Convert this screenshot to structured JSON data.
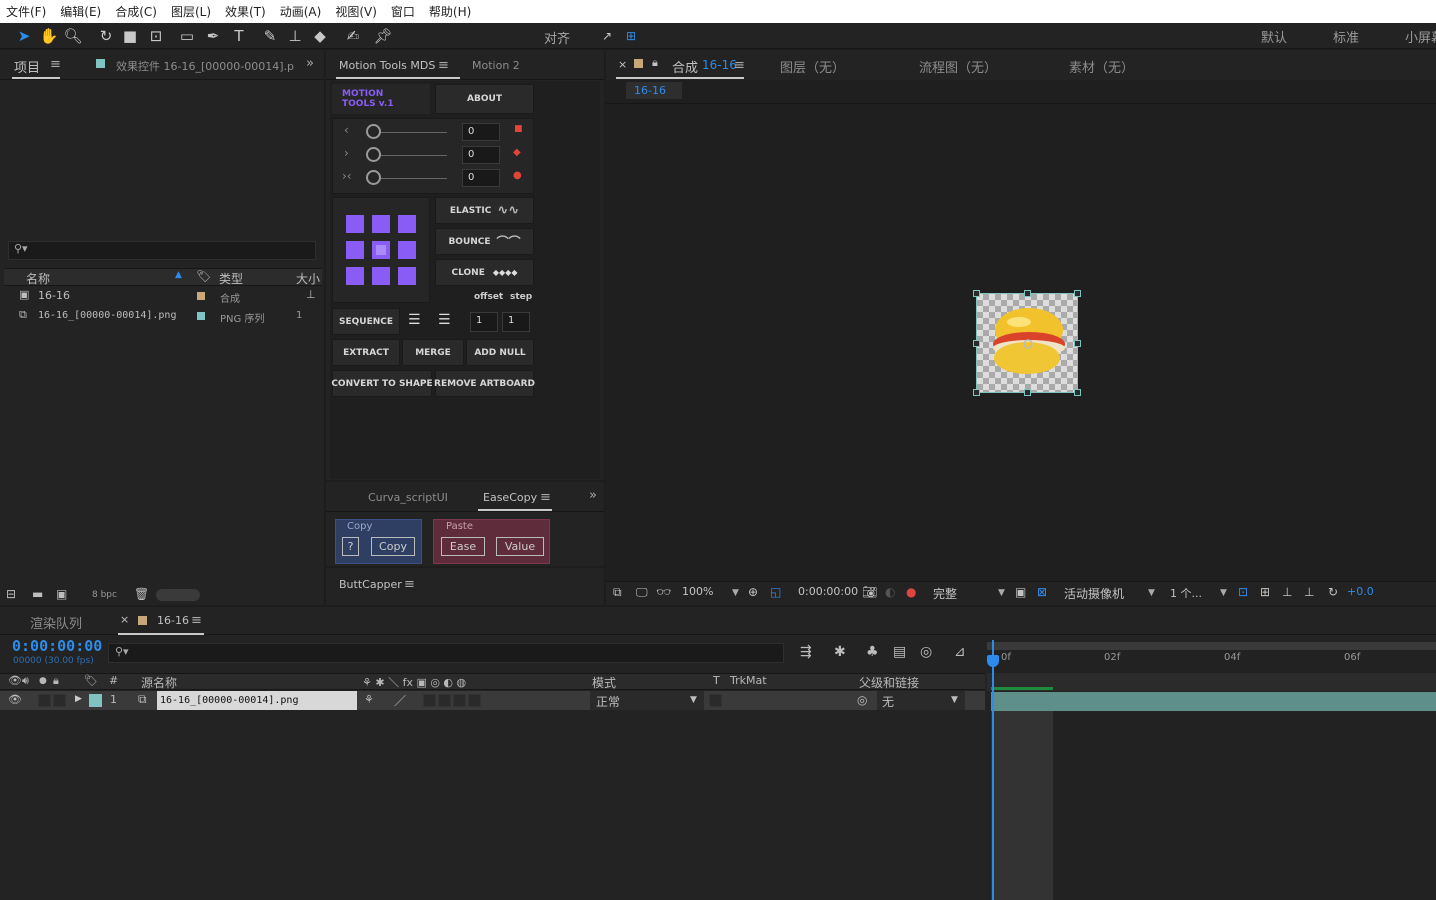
{
  "menu": [
    "文件(F)",
    "编辑(E)",
    "合成(C)",
    "图层(L)",
    "效果(T)",
    "动画(A)",
    "视图(V)",
    "窗口",
    "帮助(H)"
  ],
  "toolbar": {
    "align_label": "对齐",
    "workspaces": [
      "默认",
      "标准",
      "小屏幕"
    ]
  },
  "project_panel": {
    "tab_project": "项目",
    "tab_effects": "效果控件 16-16_[00000-00014].p",
    "columns": {
      "name": "名称",
      "type": "类型",
      "size": "大小"
    },
    "items": [
      {
        "name": "16-16",
        "type": "合成",
        "color": "#c8a878"
      },
      {
        "name": "16-16_[00000-00014].png",
        "type": "PNG 序列",
        "color": "#7fc4c0",
        "size": "1"
      }
    ],
    "bpc": "8 bpc"
  },
  "motion_tools": {
    "tab1": "Motion Tools MDS",
    "tab2": "Motion 2",
    "logo_line1": "MOTION",
    "logo_line2": "TOOLS v.1",
    "about": "ABOUT",
    "sliders": [
      {
        "icon": "‹",
        "value": "0",
        "color": "#e0453a",
        "marker": "■"
      },
      {
        "icon": "›",
        "value": "0",
        "color": "#e0453a",
        "marker": "◆"
      },
      {
        "icon": "›‹",
        "value": "0",
        "color": "#e0453a",
        "marker": "●"
      }
    ],
    "elastic": "ELASTIC",
    "bounce": "BOUNCE",
    "clone": "CLONE",
    "offset": "offset",
    "step": "step",
    "sequence": "SEQUENCE",
    "offset_value": "1",
    "step_value": "1",
    "extract": "EXTRACT",
    "merge": "MERGE",
    "add_null": "ADD NULL",
    "convert": "CONVERT TO SHAPE",
    "remove_artboard": "REMOVE ARTBOARD",
    "accent": "#8a5cf6"
  },
  "easecopy": {
    "tab1": "Curva_scriptUI",
    "tab2": "EaseCopy",
    "copy_group": "Copy",
    "paste_group": "Paste",
    "q_button": "?",
    "copy_button": "Copy",
    "ease_button": "Ease",
    "value_button": "Value"
  },
  "buttcapper": {
    "title": "ButtCapper"
  },
  "viewer": {
    "tab_comp_prefix": "合成",
    "tab_comp_name": "16-16",
    "tab_layer": "图层（无）",
    "tab_flow": "流程图（无）",
    "tab_footage": "素材（无）",
    "sub_tab": "16-16",
    "zoom": "100%",
    "timecode": "0:00:00:00",
    "quality": "完整",
    "camera": "活动摄像机",
    "views": "1 个...",
    "exposure": "+0.0"
  },
  "timeline": {
    "tab_render": "渲染队列",
    "tab_comp": "16-16",
    "timecode": "0:00:00:00",
    "frame_info": "00000 (30.00 fps)",
    "columns": {
      "num": "#",
      "source": "源名称",
      "mode": "模式",
      "t": "T",
      "trkmat": "TrkMat",
      "parent": "父级和链接"
    },
    "layer": {
      "num": "1",
      "name": "16-16_[00000-00014].png",
      "mode": "正常",
      "parent": "无",
      "color": "#7fc4c0"
    },
    "ruler": [
      "0f",
      "02f",
      "04f",
      "06f"
    ]
  }
}
